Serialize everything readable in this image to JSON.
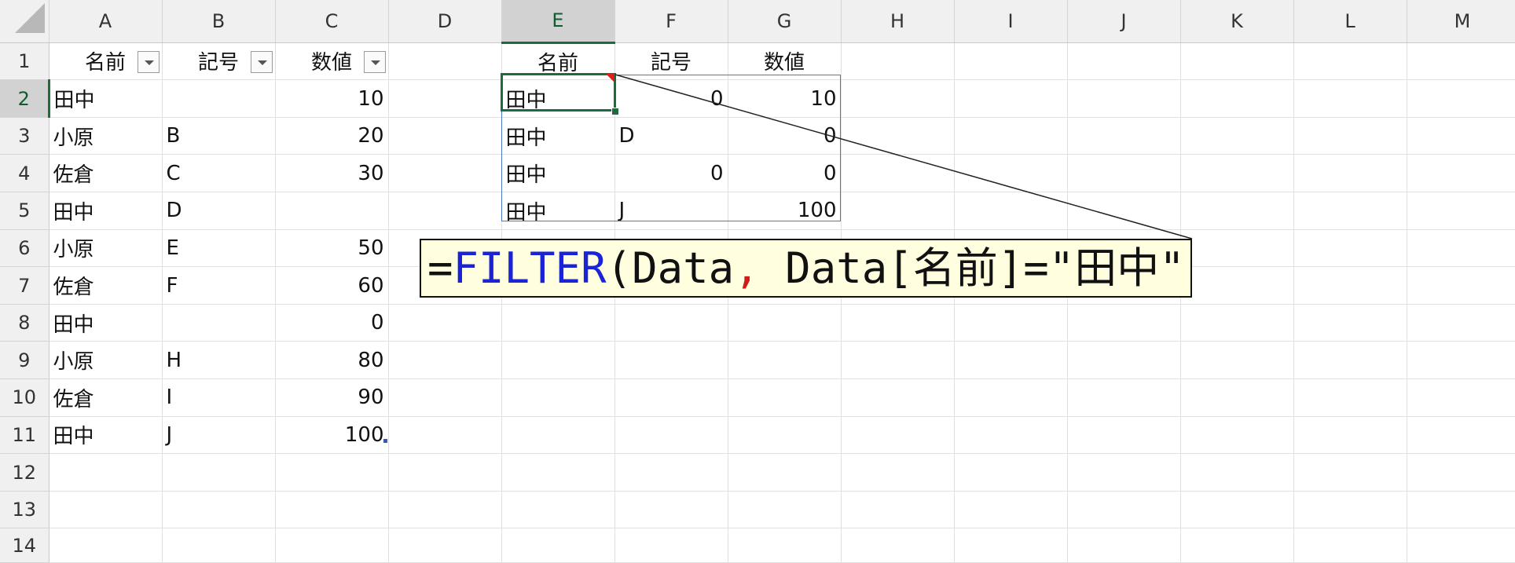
{
  "sheet": {
    "columns": [
      "A",
      "B",
      "C",
      "D",
      "E",
      "F",
      "G",
      "H",
      "I",
      "J",
      "K",
      "L",
      "M"
    ],
    "rows": [
      "1",
      "2",
      "3",
      "4",
      "5",
      "6",
      "7",
      "8",
      "9",
      "10",
      "11",
      "12",
      "13",
      "14"
    ],
    "active_cell": "E2",
    "headers": {
      "a1": "名前",
      "b1": "記号",
      "c1": "数値",
      "e1": "名前",
      "f1": "記号",
      "g1": "数値"
    },
    "source_table": [
      {
        "name": "田中",
        "code": "",
        "value": "10"
      },
      {
        "name": "小原",
        "code": "B",
        "value": "20"
      },
      {
        "name": "佐倉",
        "code": "C",
        "value": "30"
      },
      {
        "name": "田中",
        "code": "D",
        "value": ""
      },
      {
        "name": "小原",
        "code": "E",
        "value": "50"
      },
      {
        "name": "佐倉",
        "code": "F",
        "value": "60"
      },
      {
        "name": "田中",
        "code": "",
        "value": "0"
      },
      {
        "name": "小原",
        "code": "H",
        "value": "80"
      },
      {
        "name": "佐倉",
        "code": "I",
        "value": "90"
      },
      {
        "name": "田中",
        "code": "J",
        "value": "100"
      }
    ],
    "filter_result": [
      {
        "name": "田中",
        "code": "0",
        "value": "10"
      },
      {
        "name": "田中",
        "code": "D",
        "value": "0"
      },
      {
        "name": "田中",
        "code": "0",
        "value": "0"
      },
      {
        "name": "田中",
        "code": "J",
        "value": "100"
      }
    ]
  },
  "callout": {
    "eq": "=",
    "fn": "FILTER",
    "open": "(Data",
    "comma": ",",
    "rest": " Data[名前]=\"田中\")"
  }
}
